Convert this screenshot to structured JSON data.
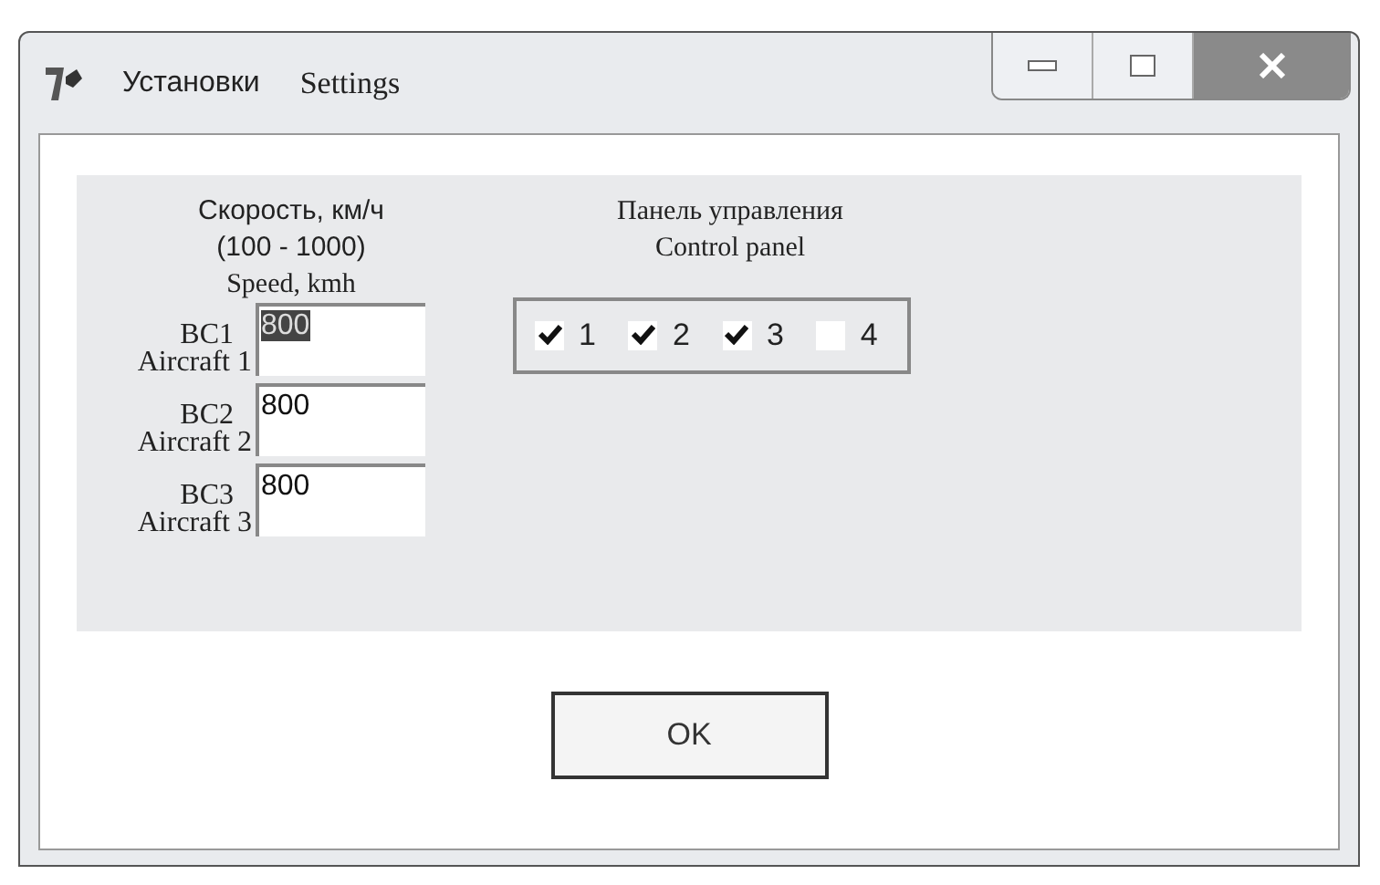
{
  "window": {
    "title_russian": "Установки",
    "title_english": "Settings"
  },
  "speed": {
    "heading_ru": "Скорость, км/ч",
    "range": "(100 - 1000)",
    "heading_en": "Speed, kmh",
    "aircraft": [
      {
        "code": "ВС1",
        "name": "Aircraft 1",
        "value": "800",
        "selected": true
      },
      {
        "code": "ВС2",
        "name": "Aircraft 2",
        "value": "800",
        "selected": false
      },
      {
        "code": "ВС3",
        "name": "Aircraft 3",
        "value": "800",
        "selected": false
      }
    ]
  },
  "control_panel": {
    "heading_ru": "Панель управления",
    "heading_en": "Control panel",
    "checkboxes": [
      {
        "label": "1",
        "checked": true
      },
      {
        "label": "2",
        "checked": true
      },
      {
        "label": "3",
        "checked": true
      },
      {
        "label": "4",
        "checked": false
      }
    ]
  },
  "buttons": [
    {
      "label": "OK"
    }
  ]
}
